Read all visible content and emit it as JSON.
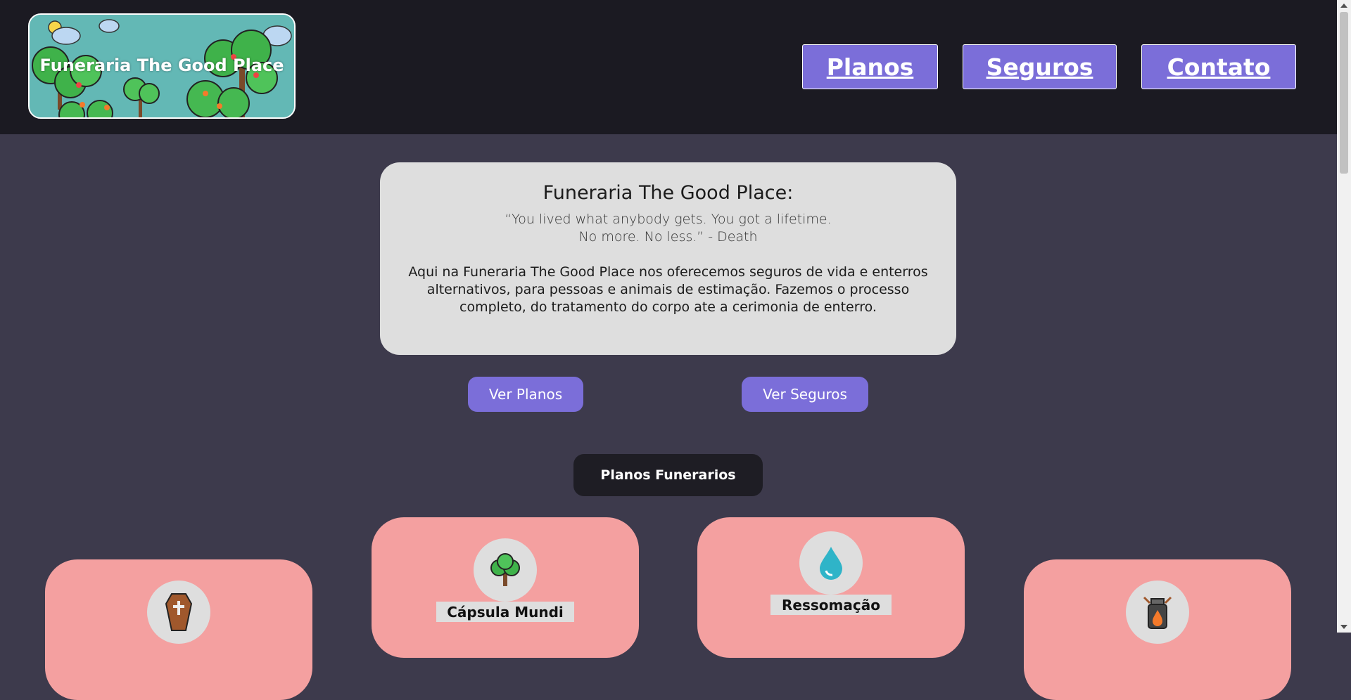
{
  "header": {
    "logo_title": "Funeraria The Good Place",
    "nav": [
      {
        "label": "Planos"
      },
      {
        "label": "Seguros"
      },
      {
        "label": "Contato"
      }
    ]
  },
  "hero": {
    "title": "Funeraria The Good Place:",
    "quote_line1": "“You lived what anybody gets. You got a lifetime.",
    "quote_line2": "No more. No less.” - Death",
    "description": "Aqui na Funeraria The Good Place nos oferecemos seguros de vida e enterros alternativos, para pessoas e animais de estimação. Fazemos o processo completo, do tratamento do corpo ate a cerimonia de enterro."
  },
  "buttons": {
    "ver_planos": "Ver Planos",
    "ver_seguros": "Ver Seguros"
  },
  "section": {
    "title": "Planos Funerarios"
  },
  "cards": [
    {
      "icon": "coffin-icon"
    },
    {
      "icon": "tree-icon",
      "label": "Cápsula Mundi"
    },
    {
      "icon": "water-drop-icon",
      "label": "Ressomação"
    },
    {
      "icon": "urn-fire-icon"
    }
  ],
  "colors": {
    "background": "#3d3a4c",
    "topbar": "#1b1a22",
    "accent": "#7b6ed9",
    "card": "#f4a0a0",
    "panel": "#dedede"
  }
}
